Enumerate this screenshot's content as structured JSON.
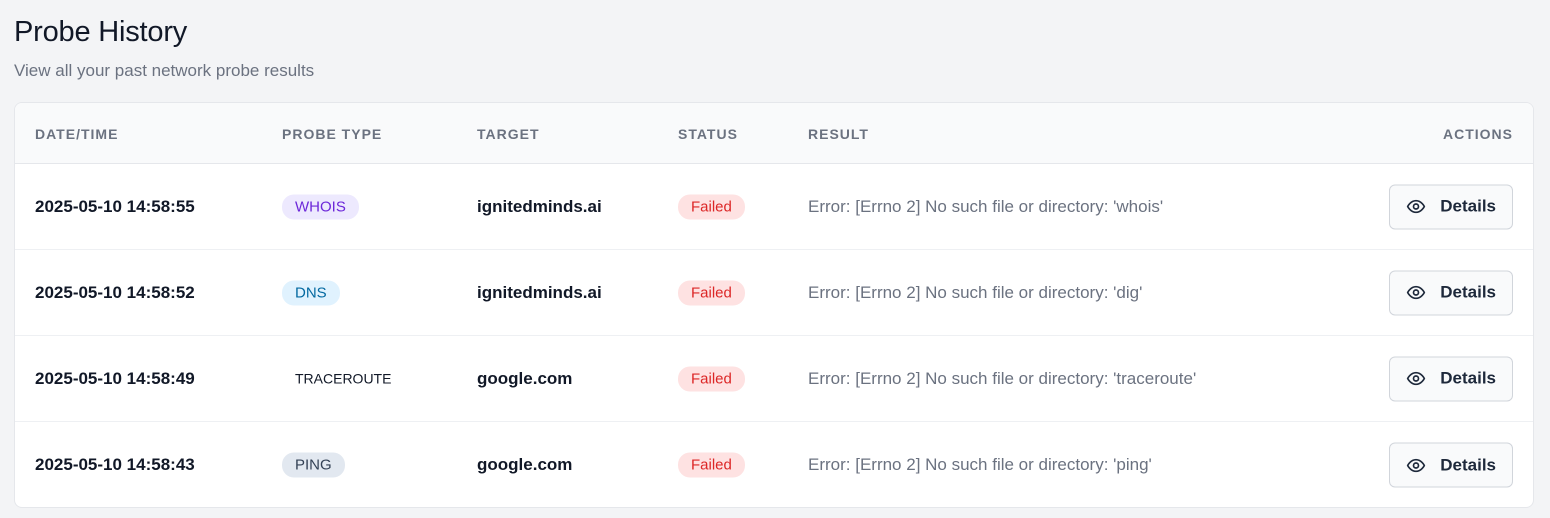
{
  "page": {
    "title": "Probe History",
    "subtitle": "View all your past network probe results"
  },
  "table": {
    "headers": {
      "datetime": "DATE/TIME",
      "probe_type": "PROBE TYPE",
      "target": "TARGET",
      "status": "STATUS",
      "result": "RESULT",
      "actions": "ACTIONS"
    },
    "rows": [
      {
        "datetime": "2025-05-10 14:58:55",
        "probe_type": "WHOIS",
        "type_key": "whois",
        "target": "ignitedminds.ai",
        "status": "Failed",
        "result": "Error: [Errno 2] No such file or directory: 'whois'",
        "action_label": "Details"
      },
      {
        "datetime": "2025-05-10 14:58:52",
        "probe_type": "DNS",
        "type_key": "dns",
        "target": "ignitedminds.ai",
        "status": "Failed",
        "result": "Error: [Errno 2] No such file or directory: 'dig'",
        "action_label": "Details"
      },
      {
        "datetime": "2025-05-10 14:58:49",
        "probe_type": "TRACEROUTE",
        "type_key": "traceroute",
        "target": "google.com",
        "status": "Failed",
        "result": "Error: [Errno 2] No such file or directory: 'traceroute'",
        "action_label": "Details"
      },
      {
        "datetime": "2025-05-10 14:58:43",
        "probe_type": "PING",
        "type_key": "ping",
        "target": "google.com",
        "status": "Failed",
        "result": "Error: [Errno 2] No such file or directory: 'ping'",
        "action_label": "Details"
      }
    ]
  },
  "colors": {
    "background": "#f3f4f6",
    "failed": "#dc2626",
    "whois": "#6d28d9",
    "dns": "#0369a1"
  },
  "icons": {
    "details": "eye-icon"
  }
}
